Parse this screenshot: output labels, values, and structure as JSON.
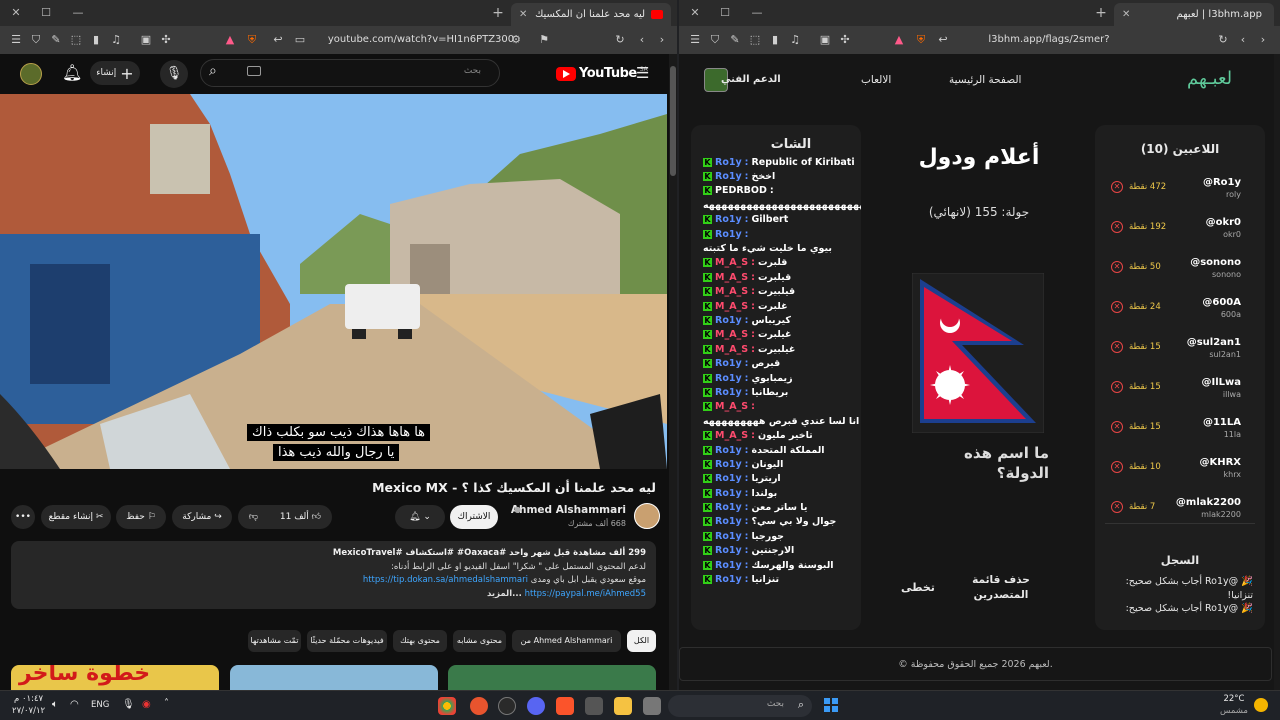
{
  "left": {
    "tab_title": "ليه محد علمنا أن المكسيك كذا ؟ - M",
    "url": "youtube.com/watch?v=HI1n6PTZ300",
    "yt": {
      "logo": "YouTube",
      "logo_sup": "SA",
      "search_placeholder": "بحث",
      "create_label": "إنشاء",
      "subtitle_line1": "ها هاها هذاك ذيب سو بكلب ذاك",
      "subtitle_line2": "يا رجال والله ذيب هذا",
      "video_title": "ليه محد علمنا أن المكسيك كذا ؟ - Mexico MX",
      "channel_name": "Ahmed Alshammari",
      "subscribers": "668 ألف مشترك",
      "subscribe_label": "الاشتراك",
      "like_count": "11 ألف",
      "share_label": "مشاركة",
      "save_label": "حفظ",
      "clip_label": "إنشاء مقطع",
      "desc_line1": "299 ألف مشاهدة  قبل شهر واحد  #Oaxaca# #استكشاف #MexicoTravel",
      "desc_line2": "لدعم المحتوى المستمل على \" شكرا\" اسفل الفيديو او على الرابط أدناه:",
      "desc_line3_text": "موقع سعودي يقبل ابل باي ومدى",
      "desc_line3_link": "https://tip.dokan.sa/ahmedalshammari",
      "desc_line4_link": "https://paypal.me/iAhmed55",
      "desc_more": "...المزيد",
      "chips": [
        "الكل",
        "من Ahmed Alshammari",
        "محتوى مشابه",
        "محتوى بهتك",
        "فيديوهات محمّلة حديثًا",
        "تمّت مشاهدتها"
      ],
      "thumb_text": "خطوة ساخر"
    }
  },
  "right": {
    "tab_title": "لعبهم | l3bhm.app",
    "url": "l3bhm.app/flags/2smer?platform=kick",
    "site": {
      "logo": "لعبـهم",
      "nav": [
        "الصفحة الرئيسية",
        "الالعاب",
        "الدعم الفني"
      ],
      "chat_title": "الشات",
      "chat": [
        {
          "user": "Ro1y",
          "msg": "Republic of Kiribati",
          "color": "#5b8dff"
        },
        {
          "user": "Ro1y",
          "msg": "اخخخ",
          "color": "#5b8dff"
        },
        {
          "user": "PEDRBOD",
          "msg": "",
          "color": "#ffffff"
        },
        {
          "user": "",
          "msg": "هههههههههههههههههههههههههههههههههههه",
          "color": "#ffffff"
        },
        {
          "user": "Ro1y",
          "msg": "Gilbert",
          "color": "#5b8dff"
        },
        {
          "user": "Ro1y",
          "msg": "",
          "color": "#5b8dff"
        },
        {
          "user": "",
          "msg": "بيوي ما خليت شيء ما كتبته",
          "color": "#ffffff"
        },
        {
          "user": "M_A_S",
          "msg": "قلبرت",
          "color": "#ff4b6e"
        },
        {
          "user": "M_A_S",
          "msg": "قيلبرت",
          "color": "#ff4b6e"
        },
        {
          "user": "M_A_S",
          "msg": "قيلبيرت",
          "color": "#ff4b6e"
        },
        {
          "user": "M_A_S",
          "msg": "غلبرت",
          "color": "#ff4b6e"
        },
        {
          "user": "Ro1y",
          "msg": "كيريباس",
          "color": "#5b8dff"
        },
        {
          "user": "M_A_S",
          "msg": "غيلبرت",
          "color": "#ff4b6e"
        },
        {
          "user": "M_A_S",
          "msg": "غيلبيرت",
          "color": "#ff4b6e"
        },
        {
          "user": "Ro1y",
          "msg": "قبرص",
          "color": "#5b8dff"
        },
        {
          "user": "Ro1y",
          "msg": "زيمبابوي",
          "color": "#5b8dff"
        },
        {
          "user": "Ro1y",
          "msg": "بريطانيا",
          "color": "#5b8dff"
        },
        {
          "user": "M_A_S",
          "msg": "",
          "color": "#ff4b6e"
        },
        {
          "user": "",
          "msg": "انا لسا عندي قبرص هههههههههه",
          "color": "#ffffff"
        },
        {
          "user": "M_A_S",
          "msg": "تاخير مليون",
          "color": "#ff4b6e"
        },
        {
          "user": "Ro1y",
          "msg": "المملكة المتحدة",
          "color": "#5b8dff"
        },
        {
          "user": "Ro1y",
          "msg": "اليونان",
          "color": "#5b8dff"
        },
        {
          "user": "Ro1y",
          "msg": "اريتريا",
          "color": "#5b8dff"
        },
        {
          "user": "Ro1y",
          "msg": "بولندا",
          "color": "#5b8dff"
        },
        {
          "user": "Ro1y",
          "msg": "يا ساتر معن",
          "color": "#5b8dff"
        },
        {
          "user": "Ro1y",
          "msg": "جوال ولا بي سي؟",
          "color": "#5b8dff"
        },
        {
          "user": "Ro1y",
          "msg": "جورجيا",
          "color": "#5b8dff"
        },
        {
          "user": "Ro1y",
          "msg": "الارجنتين",
          "color": "#5b8dff"
        },
        {
          "user": "Ro1y",
          "msg": "البوسنة والهرسك",
          "color": "#5b8dff"
        },
        {
          "user": "Ro1y",
          "msg": "تنزانيا",
          "color": "#5b8dff"
        }
      ],
      "game_title": "أعلام ودول",
      "round_text": "جولة: 155 (لانهائي)",
      "question": "ما اسم هذه الدولة؟",
      "skip_label": "تخطى",
      "clear_board_label": "حذف قائمة المتصدرين",
      "players_title": "اللاعبين (10)",
      "players": [
        {
          "name": "@Ro1y",
          "handle": "roly",
          "points": "472 نقطة"
        },
        {
          "name": "@okr0",
          "handle": "okr0",
          "points": "192 نقطة"
        },
        {
          "name": "@sonono",
          "handle": "sonono",
          "points": "50 نقطة"
        },
        {
          "name": "@600A",
          "handle": "600a",
          "points": "24 نقطة"
        },
        {
          "name": "@sul2an1",
          "handle": "sul2an1",
          "points": "15 نقطة"
        },
        {
          "name": "@IlLwa",
          "handle": "illwa",
          "points": "15 نقطة"
        },
        {
          "name": "@11LA",
          "handle": "11la",
          "points": "15 نقطة"
        },
        {
          "name": "@KHRX",
          "handle": "khrx",
          "points": "10 نقطة"
        },
        {
          "name": "@mlak2200",
          "handle": "mlak2200",
          "points": "7 نقطة"
        }
      ],
      "log_title": "السجل",
      "log": [
        "🎉 @Ro1y أجاب بشكل صحيح: تنزانيا!",
        "🎉 @Ro1y أجاب بشكل صحيح:"
      ],
      "footer": "© لعبهم 2026 جميع الحقوق محفوظة."
    }
  },
  "taskbar": {
    "time": "٠١:٤٧ م",
    "date": "٢٧/٠٧/١٢",
    "lang": "ENG",
    "search_placeholder": "بحث",
    "weather_temp": "22°C",
    "weather_desc": "مشمس"
  }
}
